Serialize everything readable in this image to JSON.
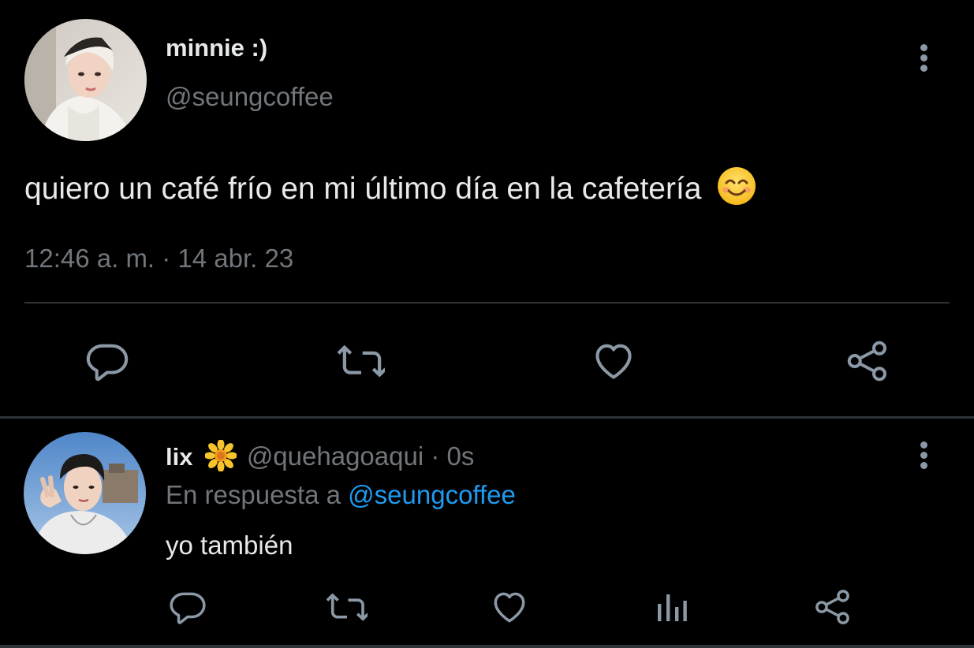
{
  "main_tweet": {
    "display_name": "minnie :)",
    "handle": "@seungcoffee",
    "text": "quiero un café frío en mi último día en la cafetería",
    "emoji_icon": "smiling-face-icon",
    "timestamp": "12:46 a. m. · 14 abr. 23",
    "actions": [
      "reply-icon",
      "retweet-icon",
      "like-icon",
      "share-icon"
    ]
  },
  "reply_tweet": {
    "display_name": "lix",
    "name_emoji_icon": "sunflower-icon",
    "handle": "@quehagoaqui",
    "separator": " · ",
    "time": "0s",
    "reply_prefix": "En respuesta a ",
    "reply_mention": "@seungcoffee",
    "text": "yo también",
    "actions": [
      "reply-icon",
      "retweet-icon",
      "like-icon",
      "views-icon",
      "share-icon"
    ]
  },
  "colors": {
    "background": "#000000",
    "primary_text": "#e7e9ea",
    "secondary_text": "#71767b",
    "accent": "#1d9bf0",
    "divider": "#2f3336"
  }
}
